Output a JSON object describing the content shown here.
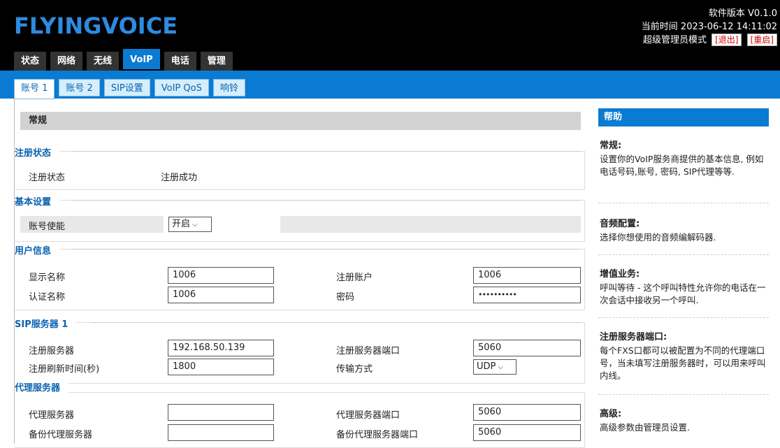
{
  "brand": {
    "logo": "FLYINGVOICE",
    "color": "#2d8be0"
  },
  "header": {
    "version": "软件版本 V0.1.0",
    "time": "当前时间 2023-06-12 14:11:02",
    "mode": "超级管理员模式",
    "logout": "[退出]",
    "reboot": "[重启]"
  },
  "main_tabs": [
    "状态",
    "网络",
    "无线",
    "VoIP",
    "电话",
    "管理"
  ],
  "sub_tabs": [
    "账号 1",
    "账号 2",
    "SIP设置",
    "VoIP QoS",
    "响铃"
  ],
  "section": "常规",
  "reg_status": {
    "group": "注册状态",
    "label": "注册状态",
    "value": "注册成功"
  },
  "basic": {
    "group": "基本设置",
    "label": "账号使能",
    "value": "开启"
  },
  "user": {
    "group": "用户信息",
    "display_name_label": "显示名称",
    "display_name": "1006",
    "reg_account_label": "注册账户",
    "reg_account": "1006",
    "auth_name_label": "认证名称",
    "auth_name": "1006",
    "password_label": "密码",
    "password": "••••••••••"
  },
  "sip": {
    "group": "SIP服务器 1",
    "server_label": "注册服务器",
    "server": "192.168.50.139",
    "port_label": "注册服务器端口",
    "port": "5060",
    "refresh_label": "注册刷新时间(秒)",
    "refresh": "1800",
    "transport_label": "传输方式",
    "transport": "UDP"
  },
  "proxy": {
    "group": "代理服务器",
    "server_label": "代理服务器",
    "server": "",
    "port_label": "代理服务器端口",
    "port": "5060",
    "backup_label": "备份代理服务器",
    "backup": "",
    "backup_port_label": "备份代理服务器端口",
    "backup_port": "5060"
  },
  "help": {
    "title": "帮助",
    "sections": [
      {
        "title": "常规:",
        "text": "设置你的VoIP服务商提供的基本信息, 例如电话号码,账号, 密码, SIP代理等等."
      },
      {
        "title": "音频配置:",
        "text": "选择你想使用的音频编解码器."
      },
      {
        "title": "增值业务:",
        "text": "呼叫等待 - 这个呼叫特性允许你的电话在一次会话中接收另一个呼叫."
      },
      {
        "title": "注册服务器端口:",
        "text": "每个FXS口都可以被配置为不同的代理端口号，当未填写注册服务器时，可以用来呼叫内线。"
      },
      {
        "title": "高级:",
        "text": "高级参数由管理员设置."
      }
    ]
  }
}
